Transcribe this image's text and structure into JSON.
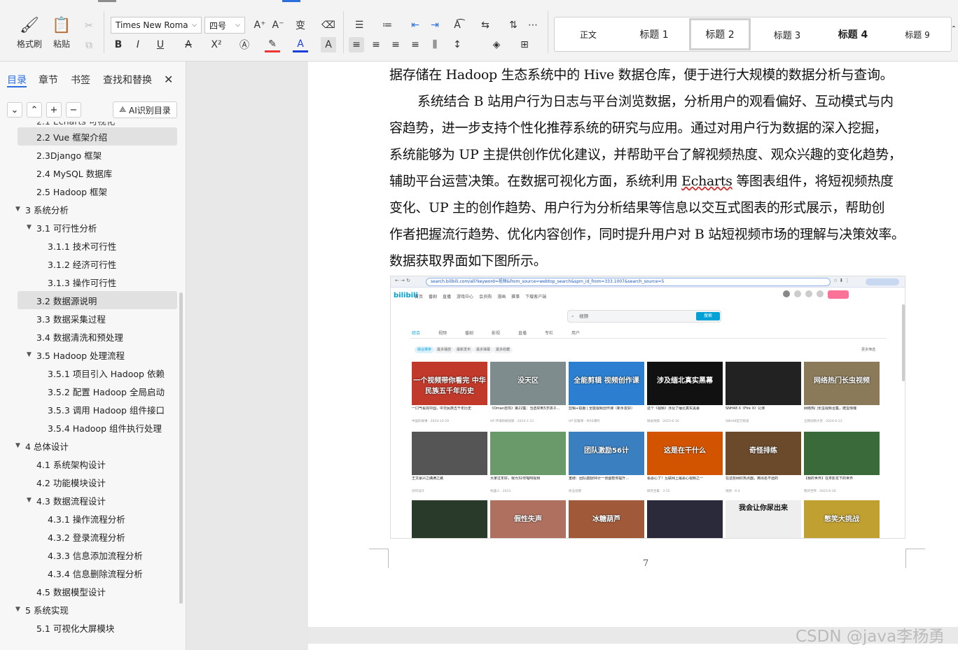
{
  "ribbon": {
    "format_painter": "格式刷",
    "paste": "粘贴",
    "font_name": "Times New Roma",
    "font_size": "四号",
    "styles": [
      "正文",
      "标题 1",
      "标题 2",
      "标题 3",
      "标题 4",
      "标题 9"
    ],
    "active_style_index": 2
  },
  "nav": {
    "tabs": [
      "目录",
      "章节",
      "书签",
      "查找和替换"
    ],
    "active_tab": 0,
    "ai_button": "AI识别目录",
    "toc_partial": "2.1 Echarts 可视化",
    "toc": [
      {
        "label": "2.2 Vue 框架介绍",
        "level": 2,
        "highlight": true
      },
      {
        "label": "2.3Django 框架",
        "level": 2
      },
      {
        "label": "2.4 MySQL 数据库",
        "level": 2
      },
      {
        "label": "2.5 Hadoop 框架",
        "level": 2
      },
      {
        "label": "3 系统分析",
        "level": 1,
        "expanded": true
      },
      {
        "label": "3.1  可行性分析",
        "level": 2,
        "expanded": true
      },
      {
        "label": "3.1.1  技术可行性",
        "level": 3
      },
      {
        "label": "3.1.2  经济可行性",
        "level": 3
      },
      {
        "label": "3.1.3  操作可行性",
        "level": 3
      },
      {
        "label": "3.2 数据源说明",
        "level": 2,
        "highlight": true
      },
      {
        "label": "3.3 数据采集过程",
        "level": 2
      },
      {
        "label": "3.4 数据清洗和预处理",
        "level": 2
      },
      {
        "label": "3.5 Hadoop 处理流程",
        "level": 2,
        "expanded": true
      },
      {
        "label": "3.5.1  项目引入 Hadoop 依赖",
        "level": 3
      },
      {
        "label": "3.5.2  配置 Hadoop 全局启动",
        "level": 3
      },
      {
        "label": "3.5.3  调用 Hadoop 组件接口",
        "level": 3
      },
      {
        "label": "3.5.4 Hadoop 组件执行处理",
        "level": 3
      },
      {
        "label": "4 总体设计",
        "level": 1,
        "expanded": true
      },
      {
        "label": "4.1 系统架构设计",
        "level": 2
      },
      {
        "label": "4.2 功能模块设计",
        "level": 2
      },
      {
        "label": "4.3 数据流程设计",
        "level": 2,
        "expanded": true
      },
      {
        "label": "4.3.1 操作流程分析",
        "level": 3
      },
      {
        "label": "4.3.2 登录流程分析",
        "level": 3
      },
      {
        "label": "4.3.3 信息添加流程分析",
        "level": 3
      },
      {
        "label": "4.3.4 信息删除流程分析",
        "level": 3
      },
      {
        "label": "4.5  数据模型设计",
        "level": 2
      },
      {
        "label": "5 系统实现",
        "level": 1,
        "expanded": true
      },
      {
        "label": "5.1  可视化大屏模块",
        "level": 2
      }
    ]
  },
  "document": {
    "lines": [
      "据存储在 Hadoop 生态系统中的 Hive 数据仓库，便于进行大规模的数据分析与查询。",
      "系统结合 B 站用户行为日志与平台浏览数据，分析用户的观看偏好、互动模式与内",
      "容趋势，进一步支持个性化推荐系统的研究与应用。通过对用户行为数据的深入挖掘，",
      "系统能够为 UP 主提供创作优化建议，并帮助平台了解视频热度、观众兴趣的变化趋势，",
      "辅助平台运营决策。在数据可视化方面，系统利用 ",
      "变化、UP 主的创作趋势、用户行为分析结果等信息以交互式图表的形式展示，帮助创",
      "作者把握流行趋势、优化内容创作，同时提升用户对 B 站短视频市场的理解与决策效率。",
      "数据获取界面如下图所示。"
    ],
    "line5_link": "Echarts",
    "line5_tail": " 等图表组件，将短视频热度",
    "page_number": "7"
  },
  "screenshot": {
    "url": "search.bilibili.com/all?keyword=视频&from_source=webtop_search&spm_id_from=333.1007&search_source=5",
    "logo": "bilibili",
    "nav_items": [
      "首页",
      "番剧",
      "直播",
      "游戏中心",
      "会员购",
      "漫画",
      "赛事",
      "下载客户端"
    ],
    "search_text": "视频",
    "search_button": "搜索",
    "tabs": [
      "综合",
      "视频",
      "番剧",
      "影视",
      "直播",
      "专栏",
      "用户"
    ],
    "pills": [
      "综合排序",
      "最多播放",
      "最新发布",
      "最多弹幕",
      "最多收藏"
    ],
    "more_filter": "更多筛选",
    "row1": [
      {
        "thumb": "一个视频带你看完 中华民族五千年历史",
        "title": "一口气看完中国，中华民族五千年历史",
        "meta": "中国的故事 · 2024-10-29"
      },
      {
        "thumb": "没天区",
        "title": "《Oman自驾》第22集：当选举到5岁孩子...",
        "meta": "UP·环球新闻视频 · 2024-1-23"
      },
      {
        "thumb": "全能剪辑 视频创作课",
        "title": "剪辑+拍摄 | 全能视频创作课（新手友好）",
        "meta": "UP·剪辑课 · 共56课时"
      },
      {
        "thumb": "涉及缅北真实黑幕",
        "title": "这个《视频》涉及了缅北真实黑幕",
        "meta": "微录视频 · 2023-6-16"
      },
      {
        "thumb": "",
        "title": "SNH48 X《Fire X》公演",
        "meta": "SNH48官方频道"
      },
      {
        "thumb": "网络热门长虫视频",
        "title": "网络热门长虫视频合集，爬虫惊魂",
        "meta": "全网动物大赏 · 2024-6-23"
      }
    ],
    "row2": [
      {
        "thumb": "",
        "title": "王文豪兴之确满之路",
        "meta": "创作设计"
      },
      {
        "thumb": "",
        "title": "大家过年好，我为32年唱响视频",
        "meta": "机器人 · 2023"
      },
      {
        "thumb": "团队激励56计",
        "title": "重磅：团队激励56计一张图帮你提升...",
        "meta": "商业说明"
      },
      {
        "thumb": "这是在干什么",
        "title": "看恶心了！互联网上最恶心视频之一",
        "meta": "搞笑合集 · 3-15"
      },
      {
        "thumb": "奇怪排练",
        "title": "在这些网红热点面，离出名不远的",
        "meta": "视频 · 6-4"
      },
      {
        "thumb": "",
        "title": "【我的世界】在末影龙下的世界",
        "meta": "我的世界 · 2023-6-16"
      }
    ],
    "row3": [
      {
        "thumb": ""
      },
      {
        "thumb": "假性失声"
      },
      {
        "thumb": "冰糖葫芦"
      },
      {
        "thumb": ""
      },
      {
        "thumb": "我会让你尿出来"
      },
      {
        "thumb": "憋笑大挑战"
      }
    ]
  },
  "watermark": "CSDN @java李杨勇"
}
